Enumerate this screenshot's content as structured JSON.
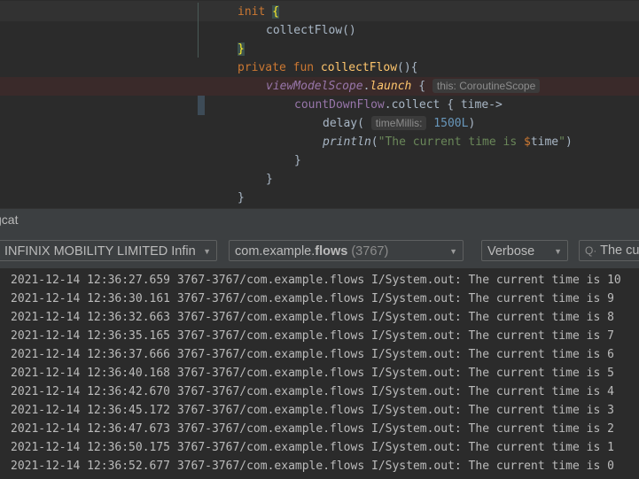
{
  "editor": {
    "lines": [
      [
        {
          "t": "init ",
          "c": "kw"
        },
        {
          "t": "{",
          "c": "brace"
        }
      ],
      [
        {
          "t": "collectFlow()",
          "c": ""
        }
      ],
      [
        {
          "t": "}",
          "c": "brace"
        }
      ],
      [
        {
          "t": "private fun ",
          "c": "kw"
        },
        {
          "t": "collectFlow",
          "c": "fn"
        },
        {
          "t": "(){",
          "c": ""
        }
      ],
      [
        {
          "t": "viewModelScope",
          "c": "ext"
        },
        {
          "t": ".",
          "c": ""
        },
        {
          "t": "launch",
          "c": "fn it"
        },
        {
          "t": " { ",
          "c": ""
        },
        {
          "t": "this: CoroutineScope",
          "c": "hint"
        }
      ],
      [
        {
          "t": "countDownFlow",
          "c": "ext2"
        },
        {
          "t": ".collect { time->",
          "c": ""
        }
      ],
      [
        {
          "t": "delay( ",
          "c": ""
        },
        {
          "t": "timeMillis:",
          "c": "hint"
        },
        {
          "t": " 1500L",
          "c": "num"
        },
        {
          "t": ")",
          "c": ""
        }
      ],
      [
        {
          "t": "println",
          "c": "it"
        },
        {
          "t": "(",
          "c": ""
        },
        {
          "t": "\"The current time is ",
          "c": "str"
        },
        {
          "t": "$",
          "c": "dollar"
        },
        {
          "t": "time",
          "c": ""
        },
        {
          "t": "\"",
          "c": "str"
        },
        {
          "t": ")",
          "c": ""
        }
      ],
      [
        {
          "t": "}",
          "c": ""
        }
      ],
      [
        {
          "t": "}",
          "c": ""
        }
      ],
      [
        {
          "t": "}",
          "c": ""
        }
      ]
    ]
  },
  "logcat": {
    "title": "gcat",
    "device": "INFINIX MOBILITY LIMITED Infin",
    "process_prefix": "com.example.",
    "process_bold": "flows",
    "process_pid": " (3767)",
    "level": "Verbose",
    "search_value": "The cu",
    "lines": [
      "2021-12-14 12:36:27.659 3767-3767/com.example.flows I/System.out: The current time is 10",
      "2021-12-14 12:36:30.161 3767-3767/com.example.flows I/System.out: The current time is 9",
      "2021-12-14 12:36:32.663 3767-3767/com.example.flows I/System.out: The current time is 8",
      "2021-12-14 12:36:35.165 3767-3767/com.example.flows I/System.out: The current time is 7",
      "2021-12-14 12:36:37.666 3767-3767/com.example.flows I/System.out: The current time is 6",
      "2021-12-14 12:36:40.168 3767-3767/com.example.flows I/System.out: The current time is 5",
      "2021-12-14 12:36:42.670 3767-3767/com.example.flows I/System.out: The current time is 4",
      "2021-12-14 12:36:45.172 3767-3767/com.example.flows I/System.out: The current time is 3",
      "2021-12-14 12:36:47.673 3767-3767/com.example.flows I/System.out: The current time is 2",
      "2021-12-14 12:36:50.175 3767-3767/com.example.flows I/System.out: The current time is 1",
      "2021-12-14 12:36:52.677 3767-3767/com.example.flows I/System.out: The current time is 0"
    ]
  }
}
